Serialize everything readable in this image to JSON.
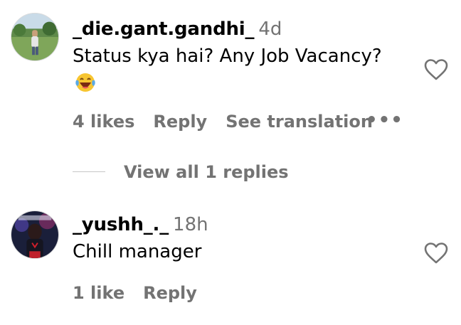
{
  "comments": [
    {
      "username": "_die.gant.gandhi_",
      "time": "4d",
      "text": "Status kya hai? Any Job Vacancy?",
      "emoji": "laughing-tears",
      "likes": "4 likes",
      "reply": "Reply",
      "translate": "See translation",
      "more": "•••",
      "view_replies": "View all 1 replies"
    },
    {
      "username": "_yushh_._",
      "time": "18h",
      "text": "Chill manager",
      "likes": "1 like",
      "reply": "Reply"
    }
  ],
  "colors": {
    "secondary": "#737373",
    "divider": "#c7c7c7"
  }
}
